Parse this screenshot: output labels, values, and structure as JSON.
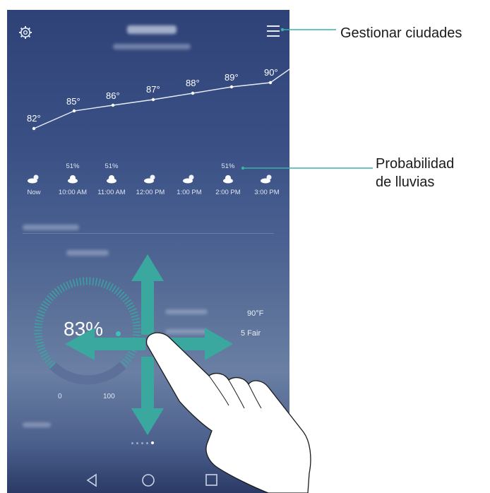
{
  "header": {
    "settings_icon": "gear-icon",
    "menu_icon": "menu-icon"
  },
  "temperatures": [
    "82°",
    "85°",
    "86°",
    "87°",
    "88°",
    "89°",
    "90°"
  ],
  "hourly": [
    {
      "time": "Now",
      "precip": "",
      "icon": "partly-cloudy-icon"
    },
    {
      "time": "10:00 AM",
      "precip": "51%",
      "icon": "cloud-icon"
    },
    {
      "time": "11:00 AM",
      "precip": "51%",
      "icon": "cloud-icon"
    },
    {
      "time": "12:00 PM",
      "precip": "",
      "icon": "partly-cloudy-icon"
    },
    {
      "time": "1:00 PM",
      "precip": "",
      "icon": "partly-cloudy-icon"
    },
    {
      "time": "2:00 PM",
      "precip": "51%",
      "icon": "cloud-icon"
    },
    {
      "time": "3:00 PM",
      "precip": "",
      "icon": "partly-cloudy-icon"
    }
  ],
  "humidity": {
    "value": "83%",
    "min_label": "0",
    "max_label": "100"
  },
  "details": {
    "feels_like": "90°F",
    "uv": "5 Fair"
  },
  "annotations": {
    "manage_cities": "Gestionar ciudades",
    "rain_line1": "Probabilidad",
    "rain_line2": "de lluvias"
  },
  "colors": {
    "accent": "#39c3b8",
    "arrow": "#2fa19a",
    "annotation_line": "#3bb0a8"
  }
}
